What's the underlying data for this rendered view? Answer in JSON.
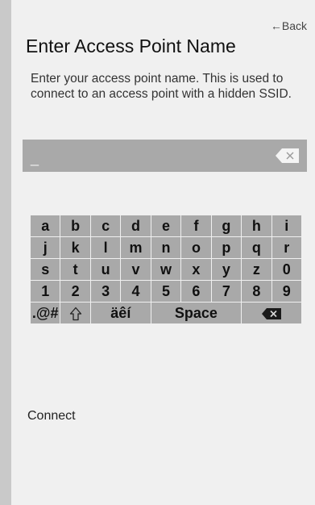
{
  "header": {
    "back_label": "←Back",
    "title": "Enter Access Point Name",
    "description": "Enter your access point name. This is used to connect to an access point with a hidden SSID."
  },
  "input": {
    "value": "_",
    "clear_icon": "clear-backspace-icon"
  },
  "keyboard": {
    "row1": [
      "a",
      "b",
      "c",
      "d",
      "e",
      "f",
      "g",
      "h",
      "i"
    ],
    "row2": [
      "j",
      "k",
      "l",
      "m",
      "n",
      "o",
      "p",
      "q",
      "r"
    ],
    "row3": [
      "s",
      "t",
      "u",
      "v",
      "w",
      "x",
      "y",
      "z",
      "0"
    ],
    "row4": [
      "1",
      "2",
      "3",
      "4",
      "5",
      "6",
      "7",
      "8",
      "9"
    ],
    "symbols_label": ".@#",
    "shift_icon": "shift-arrow-icon",
    "accents_label": "äêí",
    "space_label": "Space",
    "backspace_icon": "backspace-icon"
  },
  "footer": {
    "connect_label": "Connect"
  },
  "colors": {
    "background": "#f0f0f0",
    "key_background": "#a9a9a9",
    "outer_background": "#c9c9c9"
  }
}
